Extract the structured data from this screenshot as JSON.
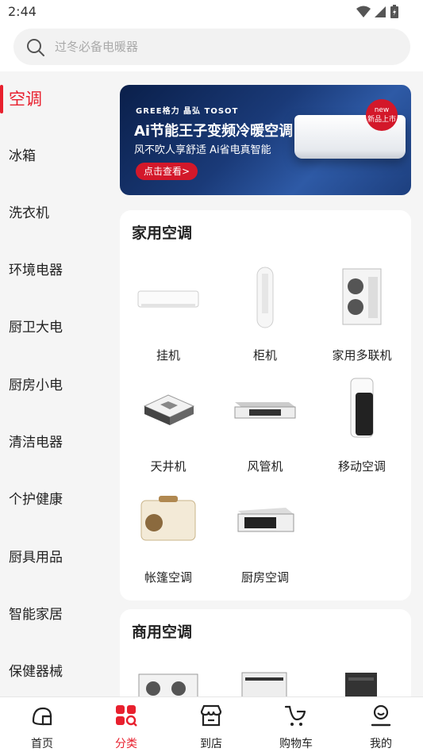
{
  "status_bar": {
    "time": "2:44"
  },
  "search": {
    "placeholder": "过冬必备电暖器"
  },
  "sidebar": {
    "items": [
      {
        "label": "空调",
        "active": true
      },
      {
        "label": "冰箱"
      },
      {
        "label": "洗衣机"
      },
      {
        "label": "环境电器"
      },
      {
        "label": "厨卫大电"
      },
      {
        "label": "厨房小电"
      },
      {
        "label": "清洁电器"
      },
      {
        "label": "个护健康"
      },
      {
        "label": "厨具用品"
      },
      {
        "label": "智能家居"
      },
      {
        "label": "保健器械"
      }
    ]
  },
  "banner": {
    "brands": "GREE格力 晶弘 TOSOT",
    "headline": "Ai节能王子变频冷暖空调",
    "subline": "风不吹人享舒适 Ai省电真智能",
    "cta": "点击查看>",
    "badge_top": "new",
    "badge_bottom": "新品上市"
  },
  "sections": [
    {
      "title": "家用空调",
      "products": [
        {
          "label": "挂机",
          "icon": "wall-ac"
        },
        {
          "label": "柜机",
          "icon": "floor-ac"
        },
        {
          "label": "家用多联机",
          "icon": "outdoor-unit"
        },
        {
          "label": "天井机",
          "icon": "ceiling-cassette"
        },
        {
          "label": "风管机",
          "icon": "duct-unit"
        },
        {
          "label": "移动空调",
          "icon": "portable-ac"
        },
        {
          "label": "帐篷空调",
          "icon": "tent-ac"
        },
        {
          "label": "厨房空调",
          "icon": "kitchen-ac"
        }
      ]
    },
    {
      "title": "商用空调",
      "products": []
    }
  ],
  "tabbar": {
    "items": [
      {
        "label": "首页",
        "icon": "home-icon"
      },
      {
        "label": "分类",
        "icon": "category-icon",
        "active": true
      },
      {
        "label": "到店",
        "icon": "store-icon"
      },
      {
        "label": "购物车",
        "icon": "cart-icon"
      },
      {
        "label": "我的",
        "icon": "profile-icon"
      }
    ]
  },
  "colors": {
    "accent": "#e8202e",
    "banner_bg": "#1a3a78"
  }
}
